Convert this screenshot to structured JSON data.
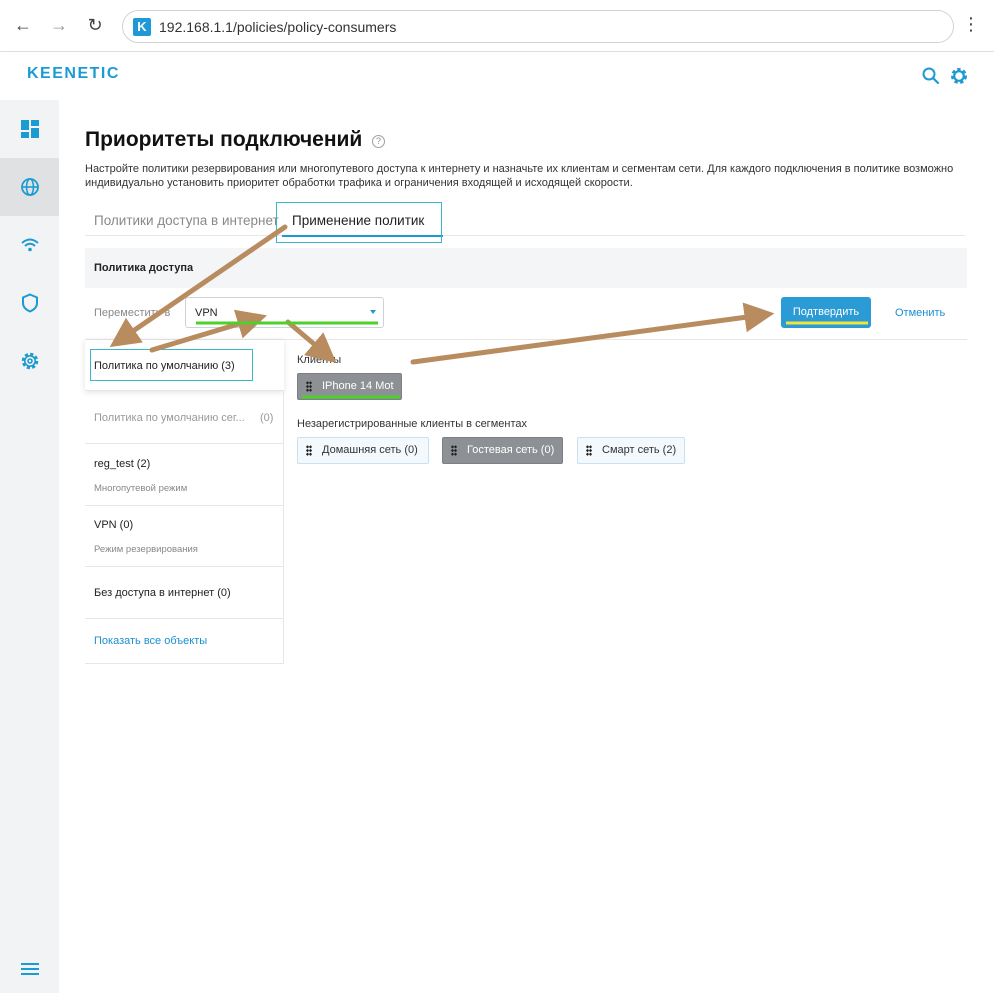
{
  "browser": {
    "back_icon": "arrow-left-icon",
    "forward_icon": "arrow-right-icon",
    "reload_icon": "reload-icon",
    "site_icon_letter": "K",
    "url": "192.168.1.1/policies/policy-consumers",
    "menu_icon": "kebab-icon"
  },
  "header": {
    "logo": "KEENETIC",
    "search_icon": "search-icon",
    "settings_icon": "gear-icon",
    "accent_color": "#1b9bd1"
  },
  "sidebar": {
    "items": [
      {
        "icon": "dashboard-icon",
        "active": false
      },
      {
        "icon": "globe-icon",
        "active": true
      },
      {
        "icon": "wifi-icon",
        "active": false
      },
      {
        "icon": "shield-icon",
        "active": false
      },
      {
        "icon": "gear-icon",
        "active": false
      }
    ],
    "bottom_icon": "hamburger-icon"
  },
  "page": {
    "title": "Приоритеты подключений",
    "help_glyph": "?",
    "description": "Настройте политики резервирования или многопутевого доступа к интернету и назначьте их клиентам и сегментам сети. Для каждого подключения в политике возможно индивидуально установить приоритет обработки трафика и ограничения входящей и исходящей скорости.",
    "tabs": [
      {
        "label": "Политики доступа в интернет",
        "active": false
      },
      {
        "label": "Применение политик",
        "active": true
      }
    ],
    "section_title": "Политика доступа",
    "move_label": "Переместить в",
    "move_select_value": "VPN",
    "confirm_label": "Подтвердить",
    "cancel_label": "Отменить"
  },
  "policies": [
    {
      "name": "Политика по умолчанию (3)",
      "subtitle": "",
      "count": "",
      "selected": true,
      "muted": false
    },
    {
      "name": "Политика по умолчанию сег...",
      "subtitle": "",
      "count": "(0)",
      "selected": false,
      "muted": true
    },
    {
      "name": "reg_test (2)",
      "subtitle": "Многопутевой режим",
      "count": "",
      "selected": false,
      "muted": false
    },
    {
      "name": "VPN (0)",
      "subtitle": "Режим резервирования",
      "count": "",
      "selected": false,
      "muted": false
    },
    {
      "name": "Без доступа в интернет (0)",
      "subtitle": "",
      "count": "",
      "selected": false,
      "muted": false
    }
  ],
  "show_all_label": "Показать все объекты",
  "clients": {
    "label": "Клиенты",
    "items": [
      {
        "name": "IPhone 14 Mot",
        "selected": true
      }
    ]
  },
  "segments": {
    "label": "Незарегистрированные клиенты в сегментах",
    "items": [
      {
        "name": "Домашняя сеть (0)",
        "selected": false
      },
      {
        "name": "Гостевая сеть (0)",
        "selected": true
      },
      {
        "name": "Смарт сеть (2)",
        "selected": false
      }
    ]
  },
  "annotation_colors": {
    "arrow": "#b98c60",
    "green_underline": "#4cd12a",
    "yellow_underline": "#f3e33c",
    "highlight_box": "#37b7c9"
  }
}
